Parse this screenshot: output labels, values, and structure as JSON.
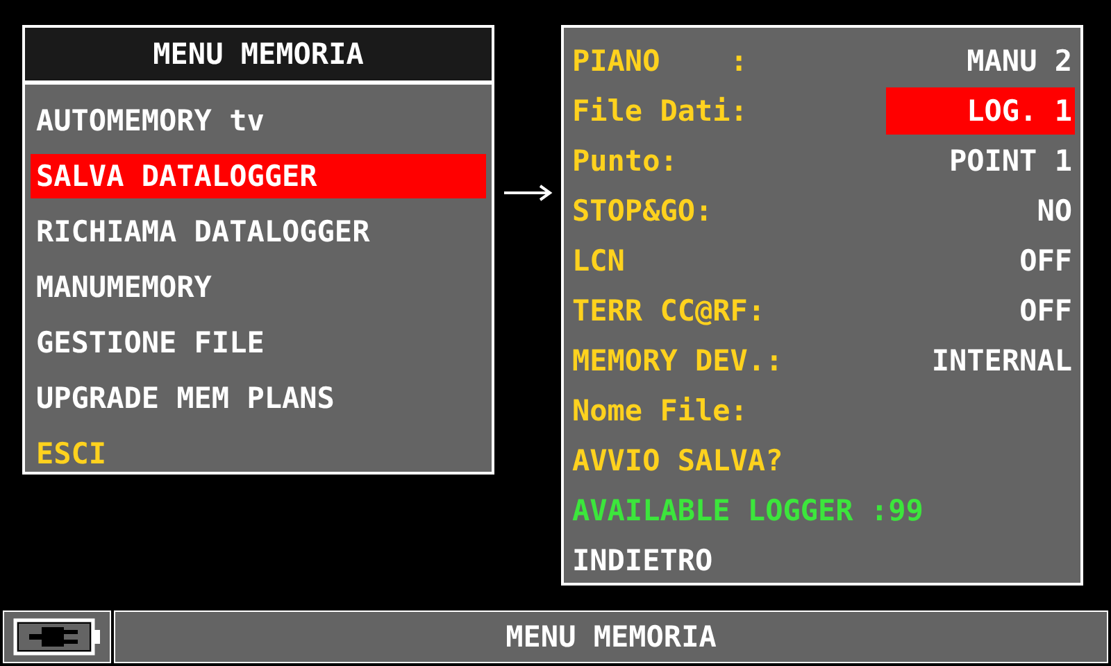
{
  "menu": {
    "title": "MENU MEMORIA",
    "items": [
      {
        "label": "AUTOMEMORY tv",
        "selected": false,
        "kind": "option"
      },
      {
        "label": "SALVA DATALOGGER",
        "selected": true,
        "kind": "option"
      },
      {
        "label": "RICHIAMA DATALOGGER",
        "selected": false,
        "kind": "option"
      },
      {
        "label": "MANUMEMORY",
        "selected": false,
        "kind": "option"
      },
      {
        "label": "GESTIONE FILE",
        "selected": false,
        "kind": "option"
      },
      {
        "label": "UPGRADE MEM PLANS",
        "selected": false,
        "kind": "option"
      },
      {
        "label": "ESCI",
        "selected": false,
        "kind": "exit"
      }
    ]
  },
  "settings": {
    "rows": [
      {
        "label": "PIANO    :",
        "value": "MANU 2",
        "selected": false,
        "color": "#ffd21e"
      },
      {
        "label": "File Dati:",
        "value": "LOG. 1",
        "selected": true,
        "color": "#ffd21e"
      },
      {
        "label": "Punto:",
        "value": "POINT 1",
        "selected": false,
        "color": "#ffd21e"
      },
      {
        "label": "STOP&GO:",
        "value": "NO",
        "selected": false,
        "color": "#ffd21e"
      },
      {
        "label": "LCN",
        "value": "OFF",
        "selected": false,
        "color": "#ffd21e"
      },
      {
        "label": "TERR CC@RF:",
        "value": "OFF",
        "selected": false,
        "color": "#ffd21e"
      },
      {
        "label": "MEMORY DEV.:",
        "value": "INTERNAL",
        "selected": false,
        "color": "#ffd21e"
      },
      {
        "label": "Nome File:",
        "selected": false,
        "color": "#ffd21e"
      },
      {
        "label": "AVVIO SALVA?",
        "selected": false,
        "color": "#ffd21e"
      },
      {
        "label": "AVAILABLE LOGGER :99",
        "selected": false,
        "color": "#3ce63c"
      },
      {
        "label": "INDIETRO",
        "selected": false,
        "color": "#ffffff"
      }
    ]
  },
  "status_bar": {
    "title": "MENU MEMORIA"
  }
}
